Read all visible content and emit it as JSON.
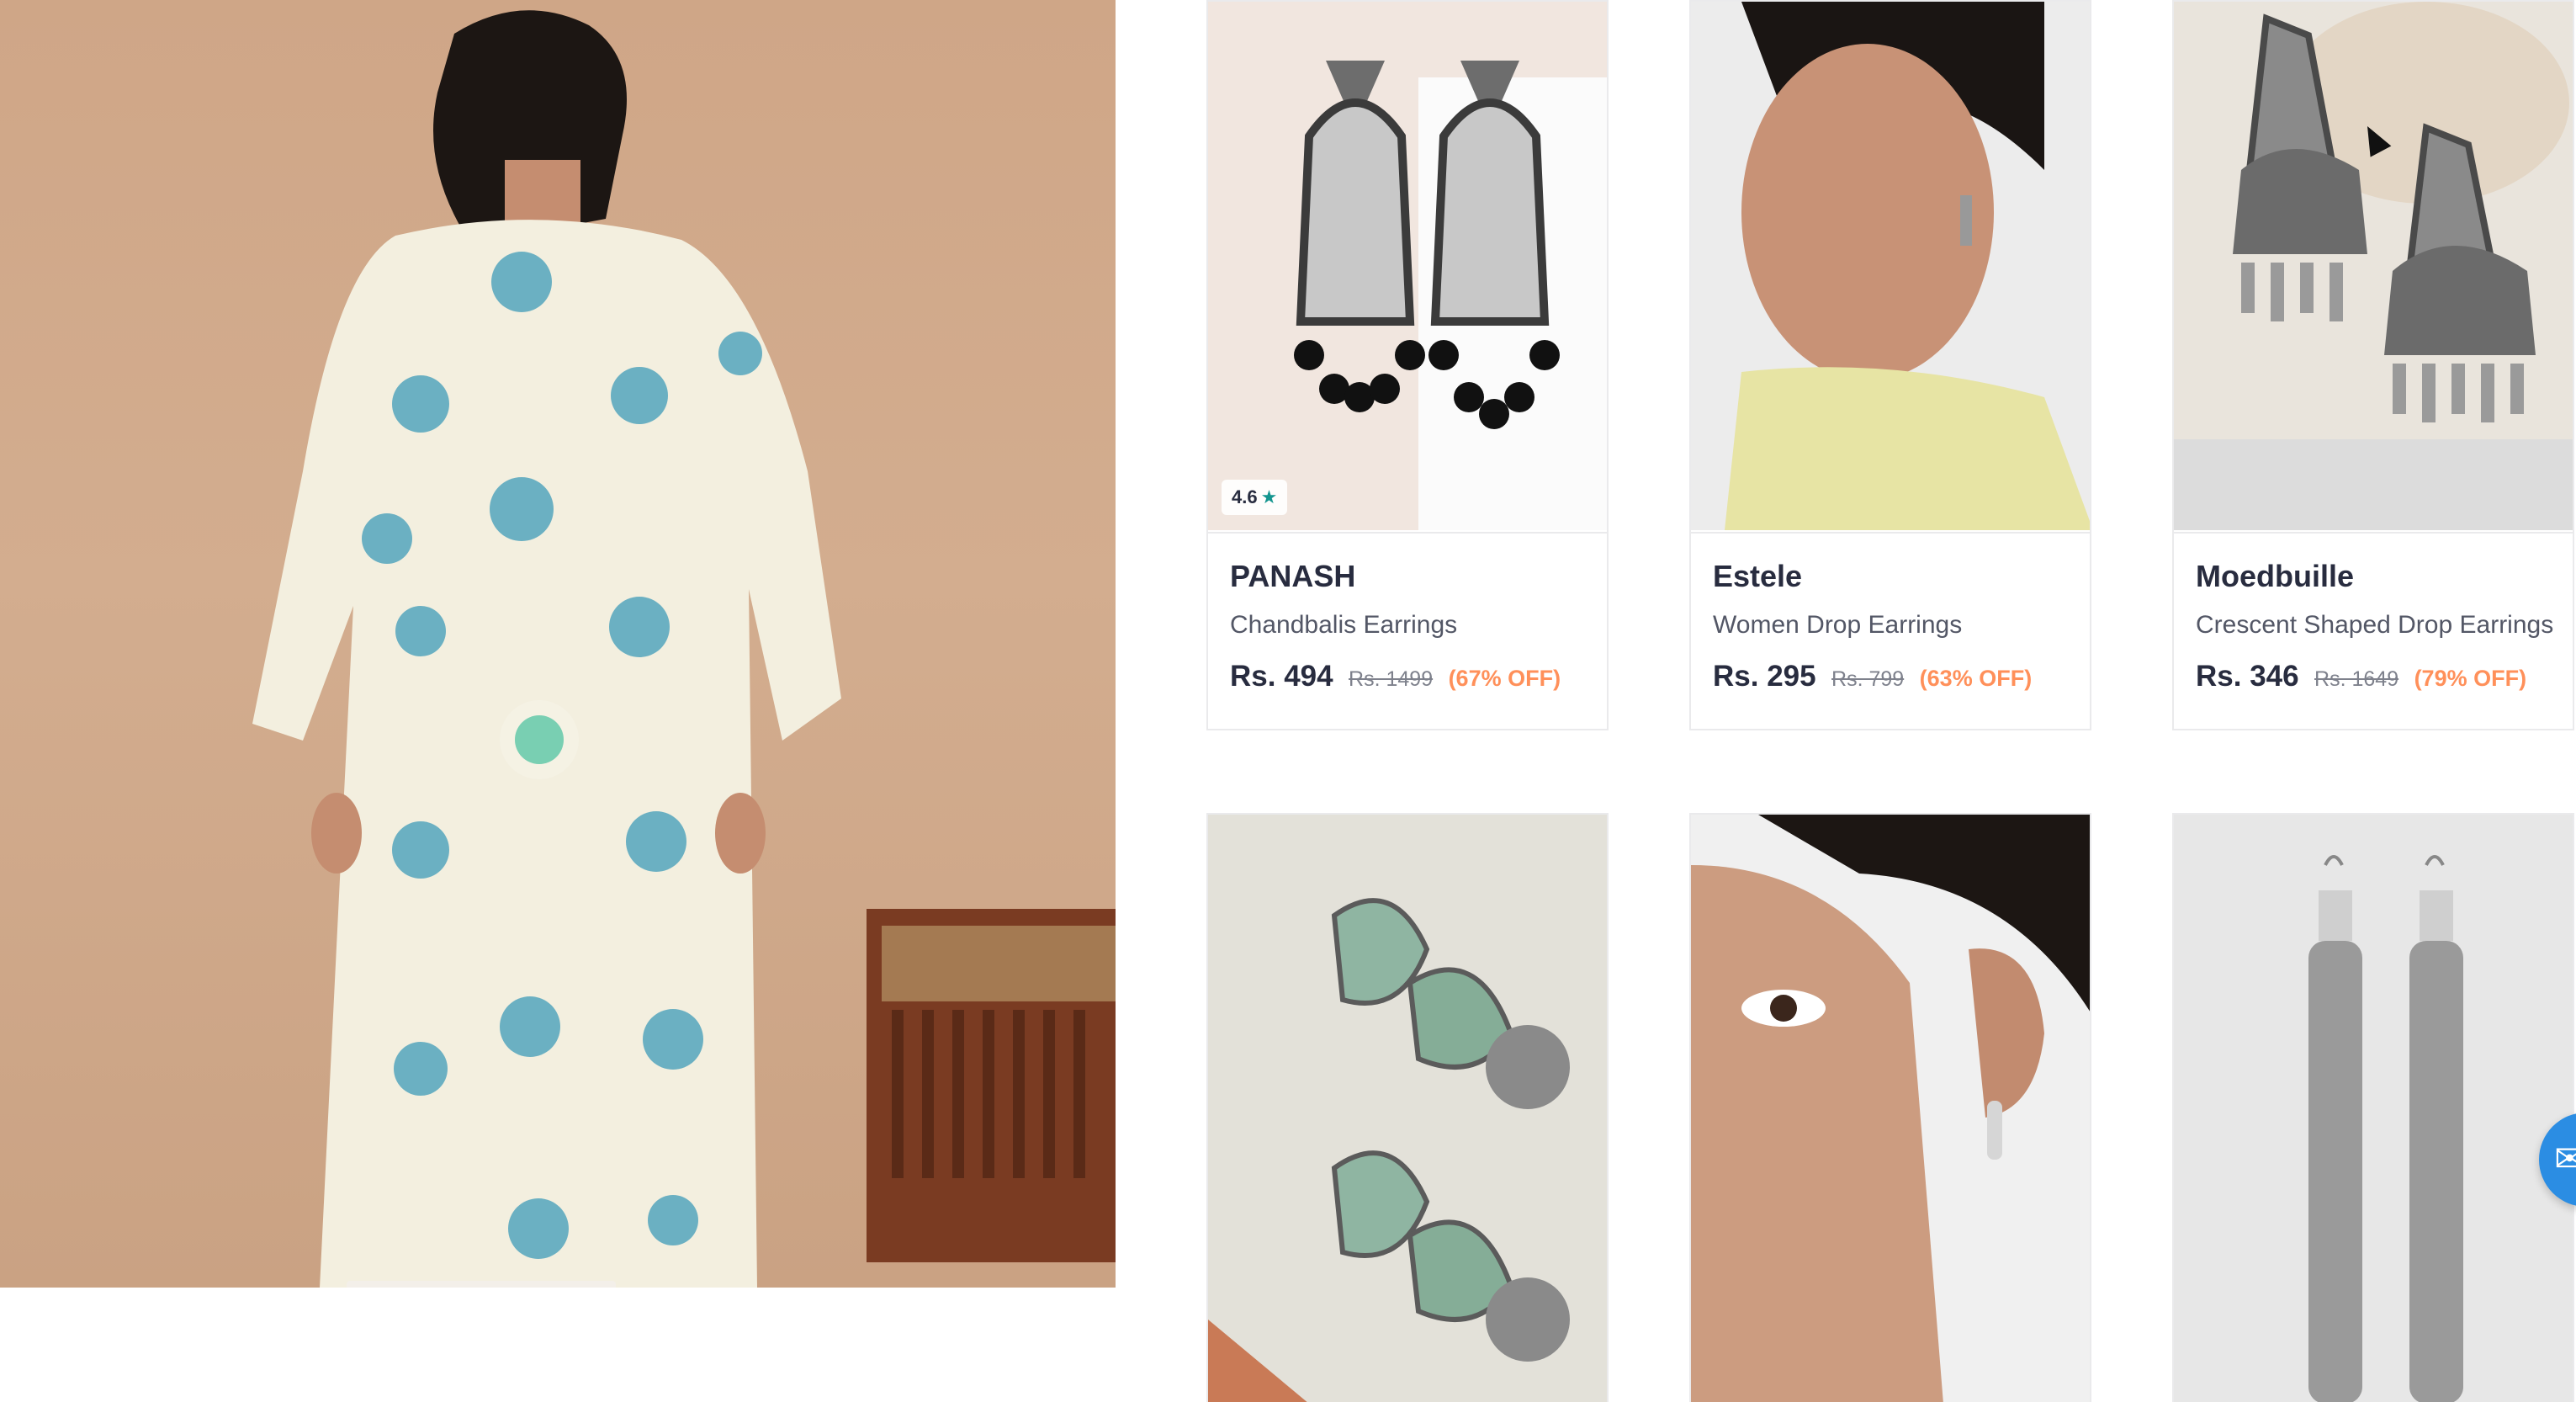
{
  "hero": {
    "alt": "hero-image"
  },
  "products": [
    {
      "brand": "PANASH",
      "name": "Chandbalis Earrings",
      "price": "Rs. 494",
      "mrp": "Rs. 1499",
      "discount": "(67% OFF)",
      "rating": "4.6",
      "rating_icon": "star-icon"
    },
    {
      "brand": "Estele",
      "name": "Women Drop Earrings",
      "price": "Rs. 295",
      "mrp": "Rs. 799",
      "discount": "(63% OFF)"
    },
    {
      "brand": "Moedbuille",
      "name": "Crescent Shaped Drop Earrings",
      "price": "Rs. 346",
      "mrp": "Rs. 1649",
      "discount": "(79% OFF)"
    }
  ],
  "colors": {
    "brand_text": "#282c3f",
    "name_text": "#535766",
    "discount": "#ff905a",
    "rating_star": "#14958f",
    "fab": "#2b8de3"
  },
  "icons": {
    "chat": "chat-icon"
  }
}
